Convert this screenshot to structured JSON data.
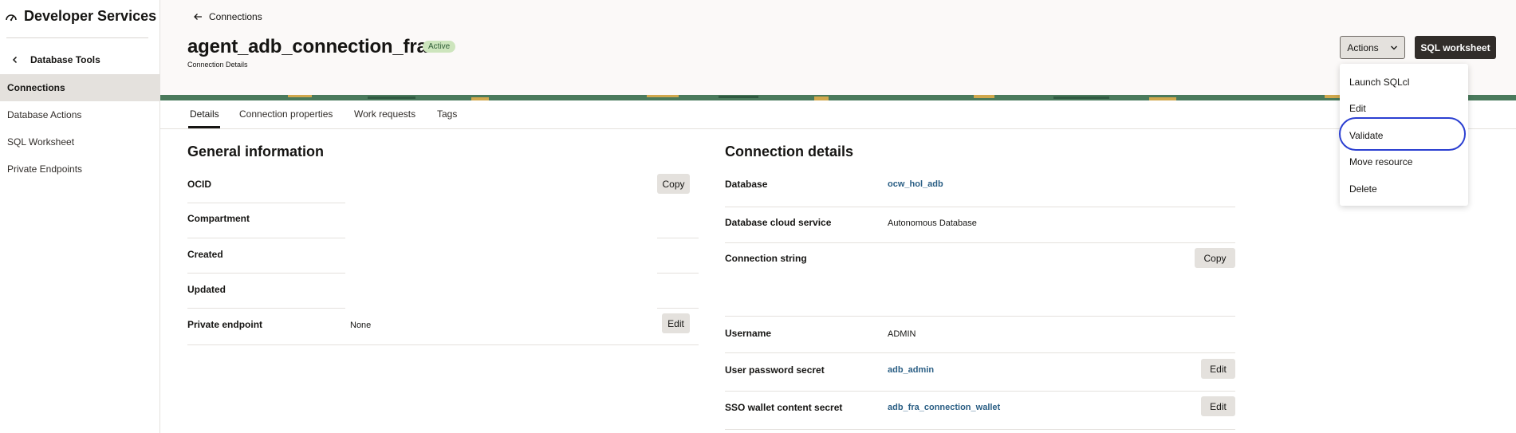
{
  "app": {
    "title": "Developer Services"
  },
  "sidebar": {
    "back_label": "Database Tools",
    "items": [
      {
        "label": "Connections",
        "active": true
      },
      {
        "label": "Database Actions"
      },
      {
        "label": "SQL Worksheet"
      },
      {
        "label": "Private Endpoints"
      }
    ]
  },
  "header": {
    "breadcrumb": "Connections",
    "title": "agent_adb_connection_fra",
    "status": "Active",
    "subtitle": "Connection Details",
    "actions_label": "Actions",
    "sql_worksheet_label": "SQL worksheet"
  },
  "tabs": [
    "Details",
    "Connection properties",
    "Work requests",
    "Tags"
  ],
  "general": {
    "title": "General information",
    "ocid_label": "OCID",
    "compartment_label": "Compartment",
    "created_label": "Created",
    "updated_label": "Updated",
    "private_endpoint_label": "Private endpoint",
    "private_endpoint_value": "None",
    "copy_label": "Copy",
    "edit_label": "Edit"
  },
  "connection": {
    "title": "Connection details",
    "database_label": "Database",
    "database_value": "ocw_hol_adb",
    "cloud_service_label": "Database cloud service",
    "cloud_service_value": "Autonomous Database",
    "conn_string_label": "Connection string",
    "username_label": "Username",
    "username_value": "ADMIN",
    "password_label": "User password secret",
    "password_value": "adb_admin",
    "sso_label": "SSO wallet content secret",
    "sso_value": "adb_fra_connection_wallet",
    "copy_label": "Copy",
    "edit_label": "Edit"
  },
  "actions_menu": {
    "items": [
      "Launch SQLcl",
      "Edit",
      "Validate",
      "Move resource",
      "Delete"
    ],
    "focused": "Validate"
  },
  "colors": {
    "accent_blue": "#2b3fd1",
    "link": "#2a5e84",
    "badge_bg": "#cde5bd",
    "dark_button": "#312d2a",
    "banner_green": "#4a7a5c"
  }
}
